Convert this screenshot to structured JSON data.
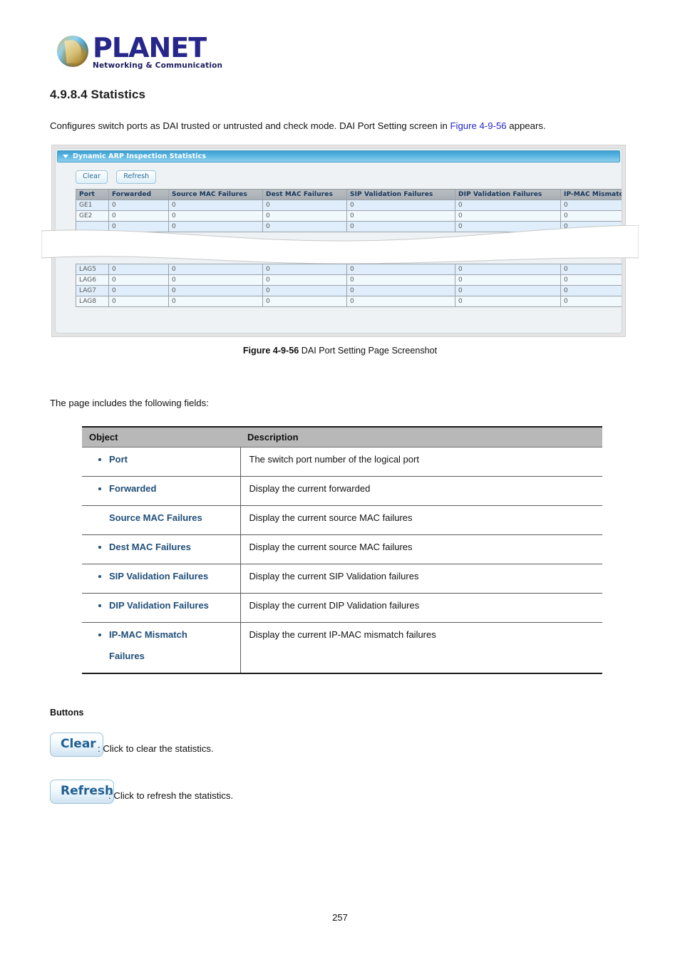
{
  "brand": {
    "name": "PLANET",
    "tagline": "Networking & Communication",
    "logo_icon": "planet-globe-logo"
  },
  "document": {
    "section_number_title": "4.9.8.4 Statistics",
    "intro_text_before": "Configures switch ports as DAI trusted or untrusted and check mode. DAI Port Setting screen in ",
    "intro_figure_link": "Figure 4-9-56",
    "intro_text_after": " appears.",
    "figure_caption_bold": "Figure 4-9-56",
    "figure_caption_rest": " DAI Port Setting Page Screenshot",
    "fields_intro": "The page includes the following fields:",
    "page_number": "257"
  },
  "screenshot": {
    "panel_title": "Dynamic ARP Inspection Statistics",
    "collapse_icon": "triangle-down-icon",
    "buttons": [
      {
        "label": "Clear"
      },
      {
        "label": "Refresh"
      }
    ],
    "table": {
      "headers": [
        "Port",
        "Forwarded",
        "Source MAC Failures",
        "Dest MAC Failures",
        "SIP Validation Failures",
        "DIP Validation Failures",
        "IP-MAC Mismatch Failures"
      ],
      "rows_top": [
        {
          "port": "GE1",
          "values": [
            "0",
            "0",
            "0",
            "0",
            "0",
            "0"
          ]
        },
        {
          "port": "GE2",
          "values": [
            "0",
            "0",
            "0",
            "0",
            "0",
            "0"
          ]
        },
        {
          "port": "",
          "values": [
            "0",
            "0",
            "0",
            "0",
            "0",
            "0"
          ]
        }
      ],
      "rows_bottom": [
        {
          "port": "LAG5",
          "values": [
            "0",
            "0",
            "0",
            "0",
            "0",
            "0"
          ]
        },
        {
          "port": "LAG6",
          "values": [
            "0",
            "0",
            "0",
            "0",
            "0",
            "0"
          ]
        },
        {
          "port": "LAG7",
          "values": [
            "0",
            "0",
            "0",
            "0",
            "0",
            "0"
          ]
        },
        {
          "port": "LAG8",
          "values": [
            "0",
            "0",
            "0",
            "0",
            "0",
            "0"
          ]
        }
      ]
    }
  },
  "fields_table": {
    "headers": [
      "Object",
      "Description"
    ],
    "rows": [
      {
        "object": "Port",
        "bullet": true,
        "description": "The switch port number of the logical port"
      },
      {
        "object": "Forwarded",
        "bullet": true,
        "description": "Display the current forwarded"
      },
      {
        "object": "Source MAC Failures",
        "bullet": false,
        "description": "Display the current source MAC failures"
      },
      {
        "object": "Dest MAC Failures",
        "bullet": true,
        "description": "Display the current source MAC failures"
      },
      {
        "object": "SIP Validation Failures",
        "bullet": true,
        "description": "Display the current SIP Validation failures"
      },
      {
        "object": "DIP Validation Failures",
        "bullet": true,
        "description": "Display the current DIP Validation failures"
      },
      {
        "object": "IP-MAC Mismatch",
        "object_line2": "Failures",
        "bullet": true,
        "description": "Display the current IP-MAC mismatch failures"
      }
    ]
  },
  "buttons_section": {
    "heading": "Buttons",
    "items": [
      {
        "label": "Clear",
        "description": ": Click to clear the statistics."
      },
      {
        "label": "Refresh",
        "description": ": Click to refresh the statistics."
      }
    ]
  },
  "colors": {
    "brand_blue": "#27268a",
    "link_blue": "#2424c8",
    "panel_header_blue": "#58b4e0",
    "table_header_gray": "#b8b8b8",
    "object_text_blue": "#1f4e79",
    "row_alt_blue": "#dfeefa"
  }
}
